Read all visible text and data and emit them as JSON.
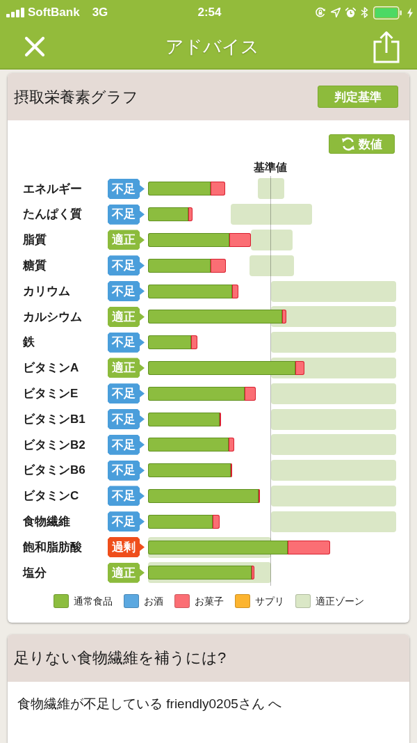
{
  "status_bar": {
    "carrier": "SoftBank",
    "network": "3G",
    "time": "2:54"
  },
  "nav_bar": {
    "title": "アドバイス"
  },
  "nutrient_card": {
    "title": "摂取栄養素グラフ",
    "criteria_button": "判定基準",
    "values_button": "数値",
    "reference_label": "基準値",
    "nutrients": [
      {
        "name": "エネルギー",
        "badge": {
          "kind": "low",
          "text": "不足"
        }
      },
      {
        "name": "たんぱく質",
        "badge": {
          "kind": "low",
          "text": "不足"
        }
      },
      {
        "name": "脂質",
        "badge": {
          "kind": "ok",
          "text": "適正"
        }
      },
      {
        "name": "糖質",
        "badge": {
          "kind": "low",
          "text": "不足"
        }
      },
      {
        "name": "カリウム",
        "badge": {
          "kind": "low",
          "text": "不足"
        }
      },
      {
        "name": "カルシウム",
        "badge": {
          "kind": "ok",
          "text": "適正"
        }
      },
      {
        "name": "鉄",
        "badge": {
          "kind": "low",
          "text": "不足"
        }
      },
      {
        "name": "ビタミンA",
        "badge": {
          "kind": "ok",
          "text": "適正"
        }
      },
      {
        "name": "ビタミンE",
        "badge": {
          "kind": "low",
          "text": "不足"
        }
      },
      {
        "name": "ビタミンB1",
        "badge": {
          "kind": "low",
          "text": "不足"
        }
      },
      {
        "name": "ビタミンB2",
        "badge": {
          "kind": "low",
          "text": "不足"
        }
      },
      {
        "name": "ビタミンB6",
        "badge": {
          "kind": "low",
          "text": "不足"
        }
      },
      {
        "name": "ビタミンC",
        "badge": {
          "kind": "low",
          "text": "不足"
        }
      },
      {
        "name": "食物繊維",
        "badge": {
          "kind": "low",
          "text": "不足"
        }
      },
      {
        "name": "飽和脂肪酸",
        "badge": {
          "kind": "high",
          "text": "過剰"
        }
      },
      {
        "name": "塩分",
        "badge": {
          "kind": "ok",
          "text": "適正"
        }
      }
    ],
    "legend": [
      {
        "label": "通常食品",
        "color": "#8cbd3f"
      },
      {
        "label": "お酒",
        "color": "#5ba8e0"
      },
      {
        "label": "お菓子",
        "color": "#fb6e74"
      },
      {
        "label": "サプリ",
        "color": "#fcb42f"
      },
      {
        "label": "適正ゾーン",
        "color": "#dae7c6"
      }
    ]
  },
  "advice_card": {
    "title": "足りない食物繊維を補うには?",
    "message": "食物繊維が不足している friendly0205さん へ"
  }
}
